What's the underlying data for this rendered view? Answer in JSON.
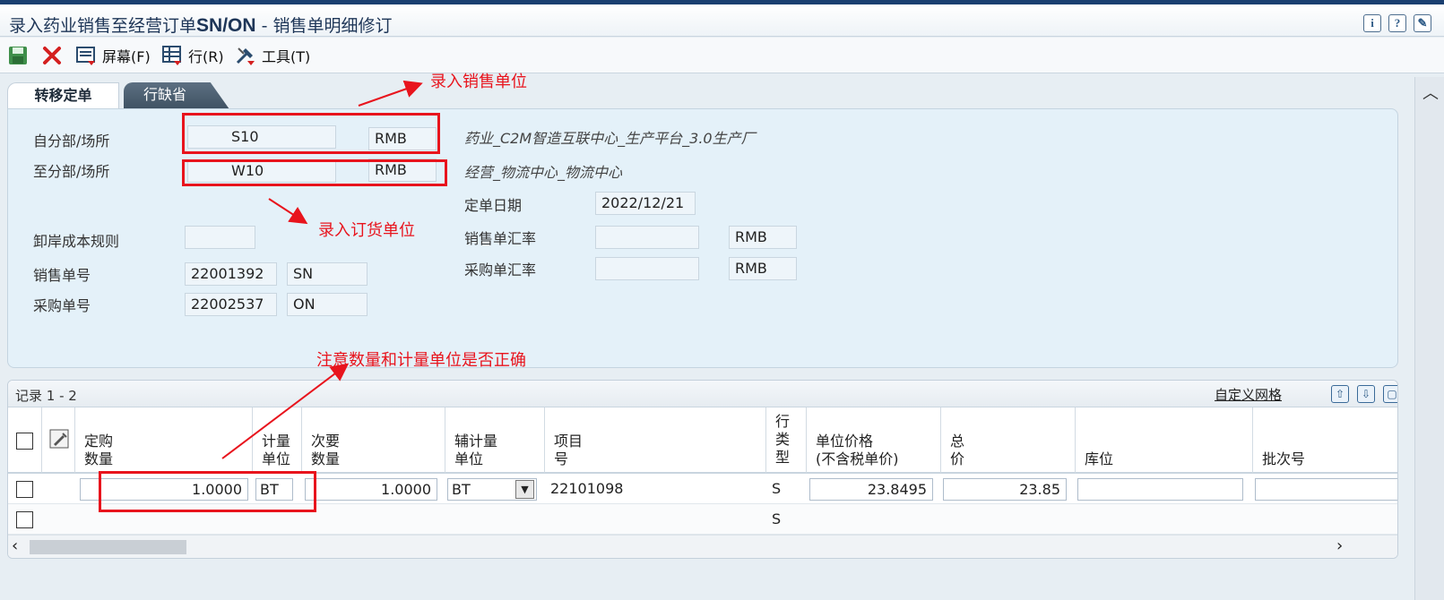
{
  "window": {
    "title_prefix": "录入药业销售至经营订单",
    "title_bold": "SN/ON",
    "title_suffix": " - 销售单明细修订",
    "icons": [
      "info-icon",
      "help-icon",
      "personalize-icon"
    ]
  },
  "toolbar": {
    "save_icon": "save-icon",
    "cancel_icon": "cancel-x-icon",
    "screen_label": "屏幕(F)",
    "row_label": "行(R)",
    "tools_label": "工具(T)"
  },
  "tabs": [
    {
      "label": "转移定单",
      "active": true
    },
    {
      "label": "行缺省",
      "active": false
    }
  ],
  "header": {
    "from_branch_label": "自分部/场所",
    "from_branch_value": "S10",
    "from_currency": "RMB",
    "from_desc": "药业_C2M智造互联中心_生产平台_3.0生产厂",
    "to_branch_label": "至分部/场所",
    "to_branch_value": "W10",
    "to_currency": "RMB",
    "to_desc": "经营_物流中心_物流中心",
    "order_date_label": "定单日期",
    "order_date_value": "2022/12/21",
    "landed_cost_label": "卸岸成本规则",
    "landed_cost_value": "",
    "sales_rate_label": "销售单汇率",
    "sales_rate_value": "",
    "sales_rate_currency": "RMB",
    "purchase_rate_label": "采购单汇率",
    "purchase_rate_value": "",
    "purchase_rate_currency": "RMB",
    "sales_no_label": "销售单号",
    "sales_no_value": "22001392",
    "sales_type": "SN",
    "purchase_no_label": "采购单号",
    "purchase_no_value": "22002537",
    "purchase_type": "ON"
  },
  "annotations": {
    "sales_unit_note": "录入销售单位",
    "order_unit_note": "录入订货单位",
    "qty_note": "注意数量和计量单位是否正确"
  },
  "grid": {
    "records": "记录 1 - 2",
    "customize_label": "自定义网格",
    "columns": [
      {
        "key": "qty",
        "l1": "定购",
        "l2": "数量"
      },
      {
        "key": "uom",
        "l1": "计量",
        "l2": "单位"
      },
      {
        "key": "qty2",
        "l1": "次要",
        "l2": "数量"
      },
      {
        "key": "uom2",
        "l1": "辅计量",
        "l2": "单位"
      },
      {
        "key": "item",
        "l1": "项目",
        "l2": "号"
      },
      {
        "key": "line_type",
        "l1": "行",
        "l2": "类",
        "l3": "型"
      },
      {
        "key": "unit_price",
        "l1": "单位价格",
        "l2": "(不含税单价)"
      },
      {
        "key": "total",
        "l1": "总",
        "l2": "价"
      },
      {
        "key": "location",
        "l1": "",
        "l2": "库位"
      },
      {
        "key": "lot",
        "l1": "",
        "l2": "批次号"
      }
    ],
    "rows": [
      {
        "qty": "1.0000",
        "uom": "BT",
        "qty2": "1.0000",
        "uom2": "BT",
        "item": "22101098",
        "line_type": "S",
        "unit_price": "23.8495",
        "total": "23.85",
        "location": "",
        "lot": ""
      },
      {
        "qty": "",
        "uom": "",
        "qty2": "",
        "uom2": "",
        "item": "",
        "line_type": "S",
        "unit_price": "",
        "total": "",
        "location": "",
        "lot": ""
      }
    ]
  },
  "colors": {
    "annotation_red": "#e8141d",
    "header_panel_bg": "#e4f1f9",
    "title_navy": "#1d3557"
  }
}
